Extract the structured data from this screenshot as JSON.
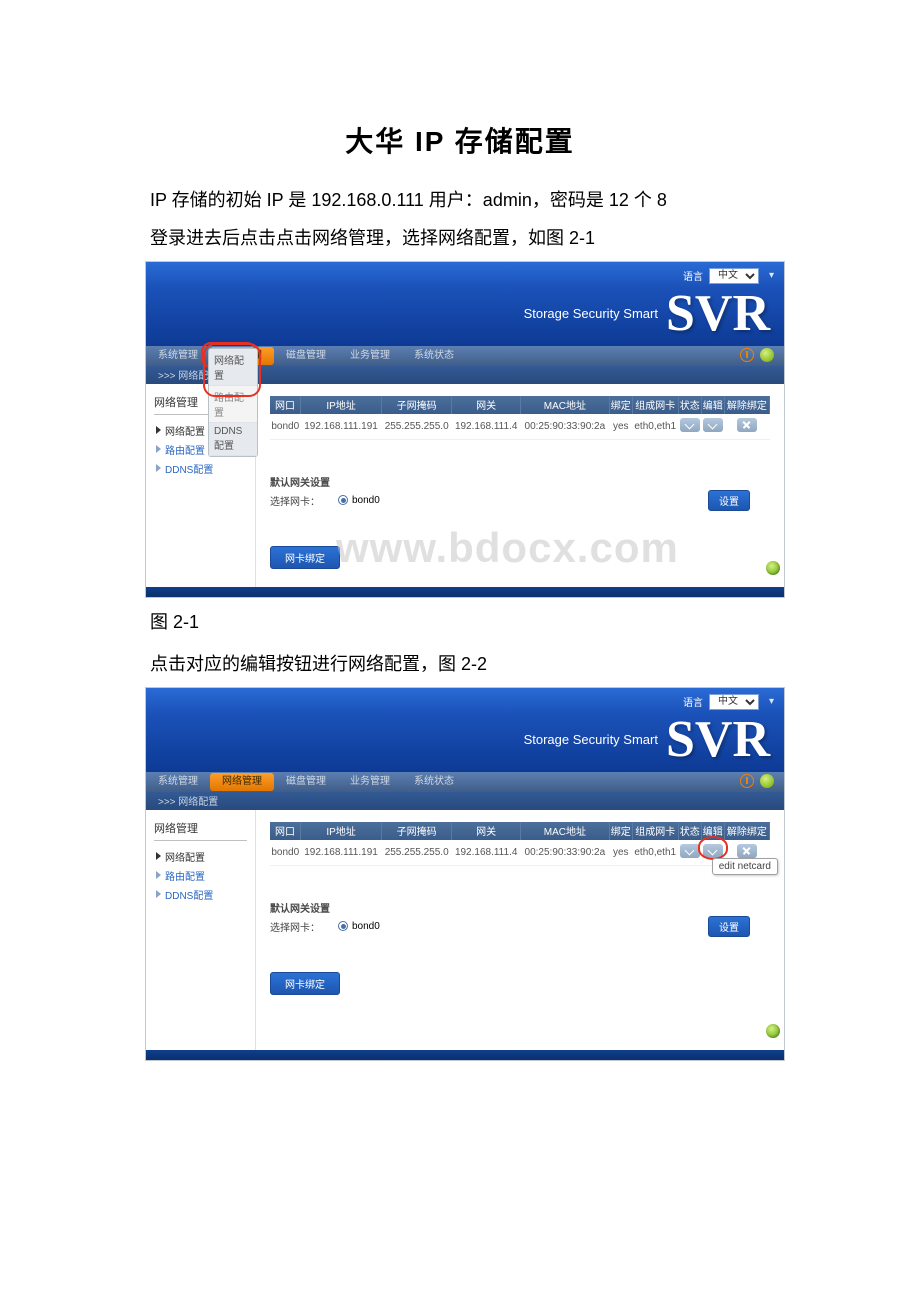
{
  "doc": {
    "title": "大华 IP 存储配置",
    "p1": "IP 存储的初始 IP 是 192.168.0.111 用户：admin，密码是 12 个 8",
    "p2": "登录进去后点击点击网络管理，选择网络配置，如图 2-1",
    "cap1": "图 2-1",
    "p3": "点击对应的编辑按钮进行网络配置，图 2-2"
  },
  "svr": {
    "brand_tagline": "Storage Security Smart",
    "brand_logo": "SVR",
    "lang_label": "语言",
    "lang_value": "中文",
    "topnav": {
      "items": [
        "系统管理",
        "网络管理",
        "磁盘管理",
        "业务管理",
        "系统状态"
      ],
      "active_index": 1
    },
    "crumb": ">>> 网络配置",
    "dropdown": {
      "items": [
        "网络配置",
        "路由配置",
        "DDNS配置"
      ]
    },
    "sidebar": {
      "title": "网络管理",
      "items": [
        {
          "label": "网络配置",
          "kind": "normal"
        },
        {
          "label": "路由配置",
          "kind": "link"
        },
        {
          "label": "DDNS配置",
          "kind": "link"
        }
      ]
    },
    "table": {
      "headers": [
        "网口",
        "IP地址",
        "子网掩码",
        "网关",
        "MAC地址",
        "绑定",
        "组成网卡",
        "状态",
        "编辑",
        "解除绑定"
      ],
      "row": {
        "port": "bond0",
        "ip": "192.168.111.191",
        "mask": "255.255.255.0",
        "gw": "192.168.111.4",
        "mac": "00:25:90:33:90:2a",
        "bind": "yes",
        "members": "eth0,eth1"
      }
    },
    "gateway": {
      "title": "默认网关设置",
      "label": "选择网卡：",
      "value": "bond0",
      "btn": "设置"
    },
    "bindbtn": "网卡绑定",
    "watermark": "www.bdocx.com",
    "tooltip_edit": "edit netcard"
  }
}
